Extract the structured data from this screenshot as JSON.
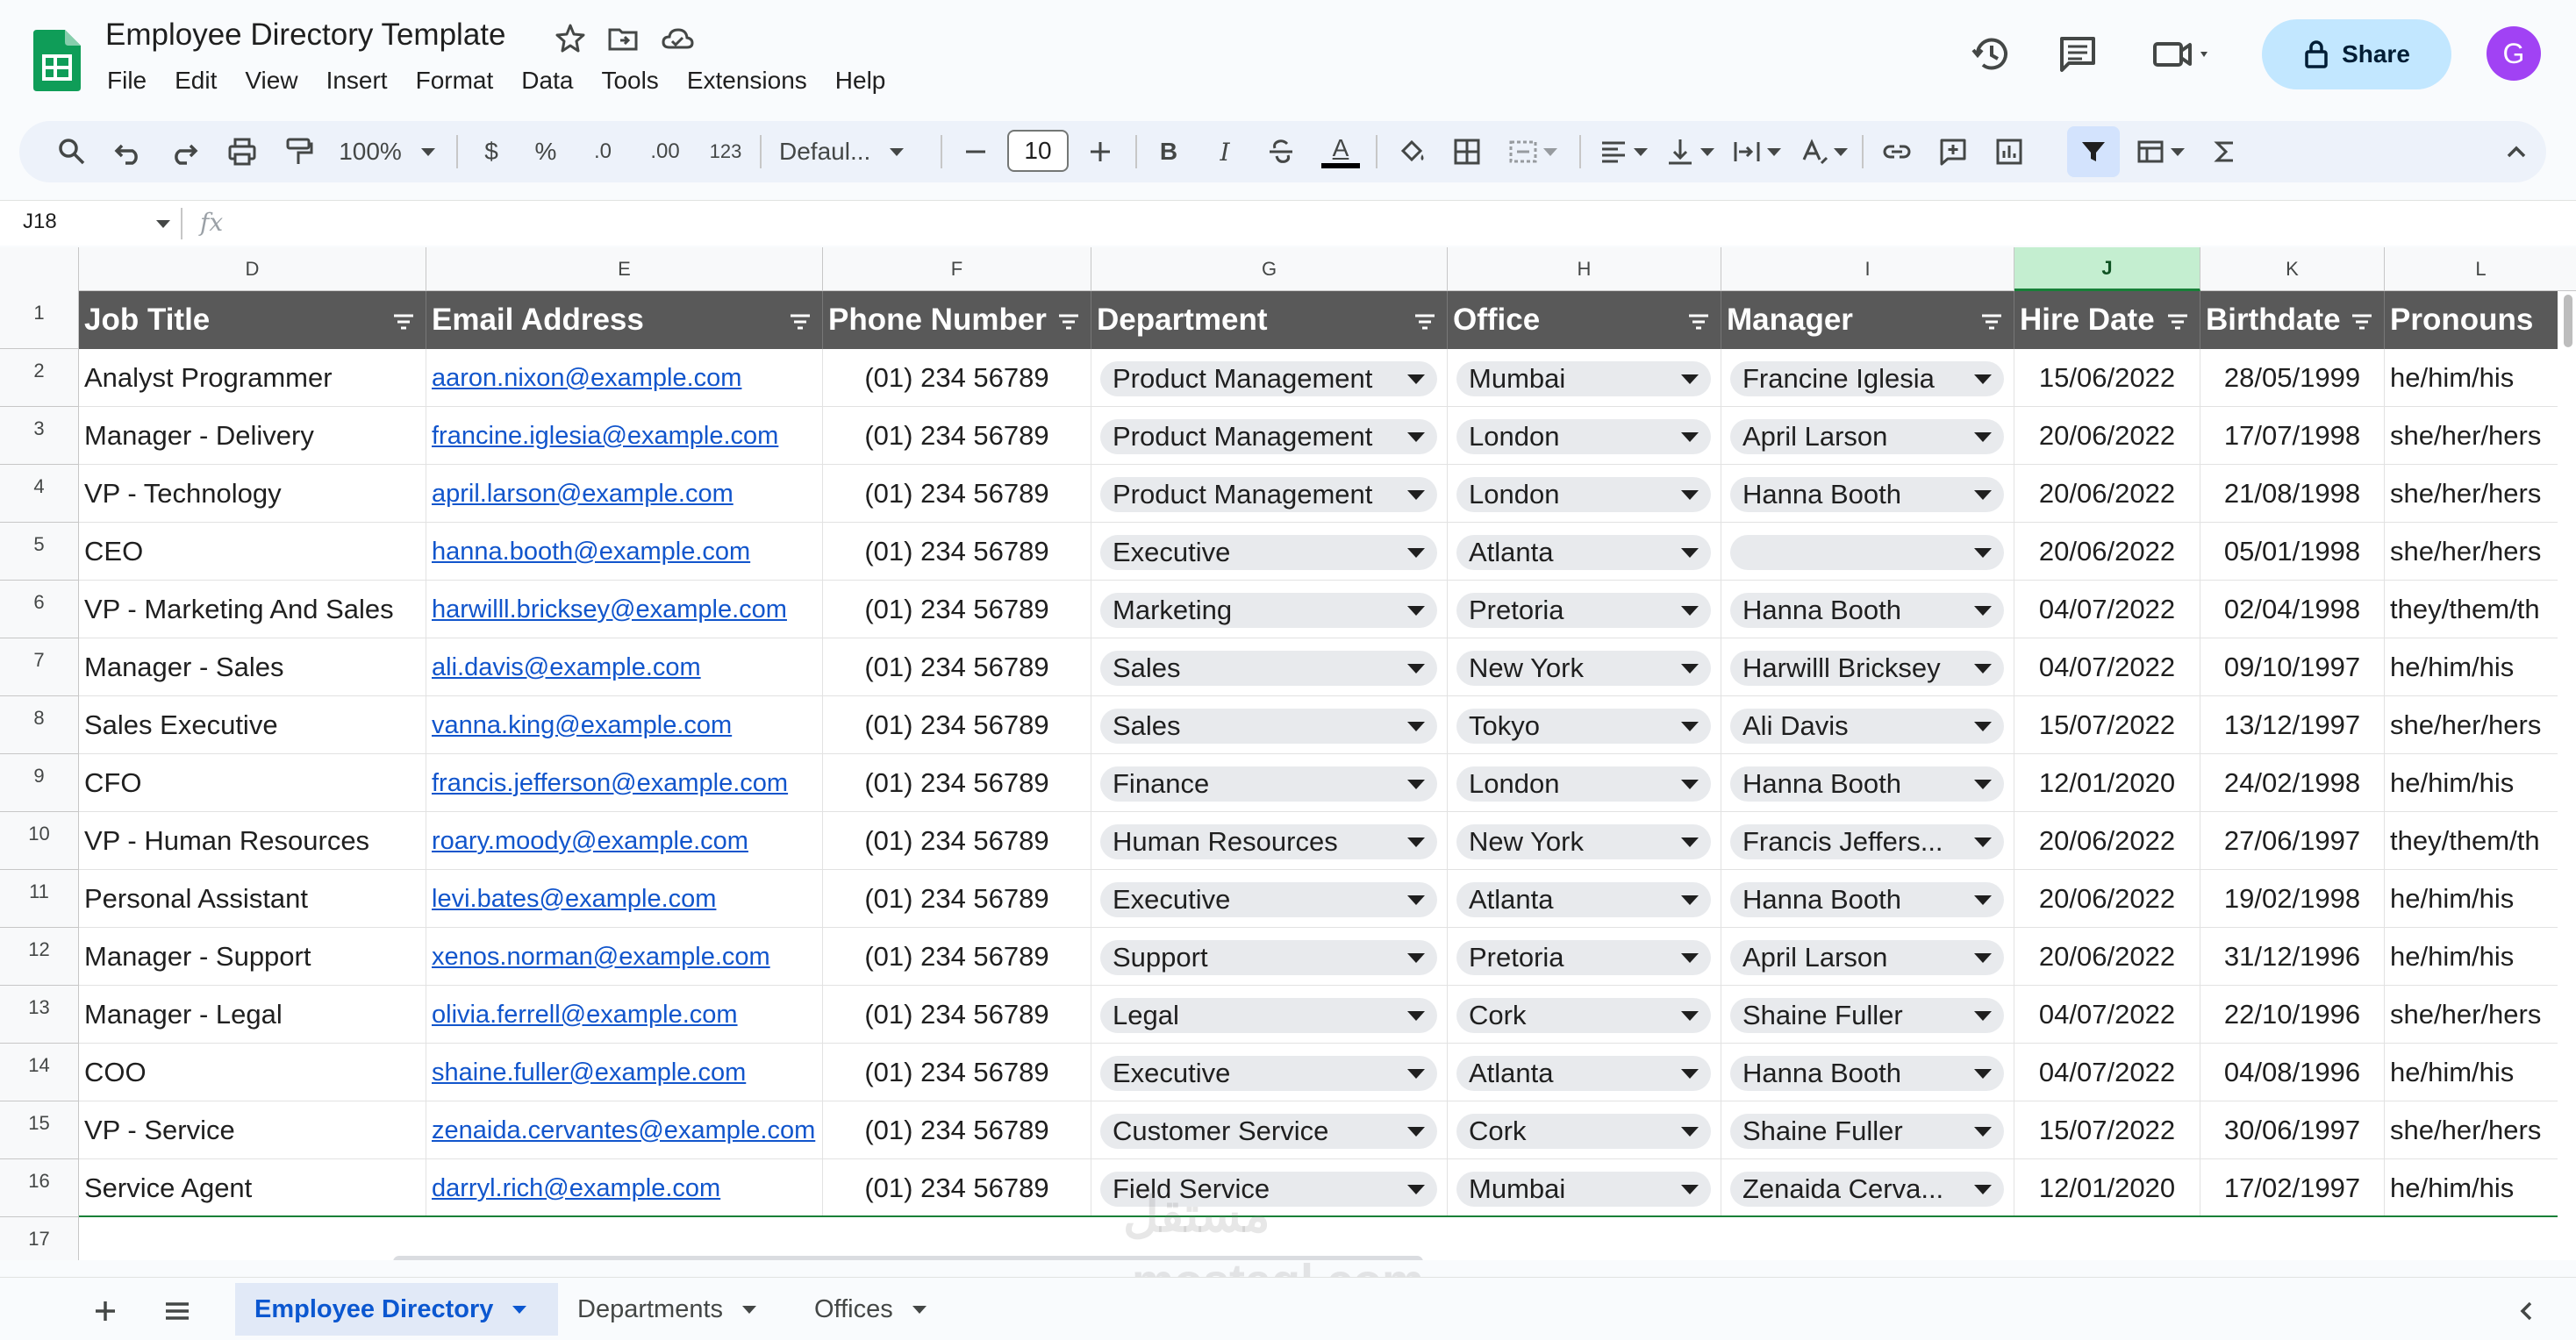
{
  "document": {
    "title": "Employee Directory Template",
    "menus": [
      "File",
      "Edit",
      "View",
      "Insert",
      "Format",
      "Data",
      "Tools",
      "Extensions",
      "Help"
    ]
  },
  "header_actions": {
    "share_label": "Share",
    "avatar_initial": "G"
  },
  "toolbar": {
    "zoom": "100%",
    "currency_symbol": "$",
    "percent_symbol": "%",
    "decrease_decimal": ".0",
    "increase_decimal": ".00",
    "number_format": "123",
    "font": "Defaul...",
    "font_size": "10",
    "bold": "B",
    "italic": "I",
    "text_color": "A",
    "icons": [
      "search-icon",
      "undo-icon",
      "redo-icon",
      "print-icon",
      "paint-format-icon",
      "font-decrease-icon",
      "font-increase-icon",
      "strikethrough-icon",
      "fill-color-icon",
      "borders-icon",
      "merge-icon",
      "align-icon",
      "valign-icon",
      "wrap-icon",
      "rotate-icon",
      "link-icon",
      "comment-icon",
      "chart-icon",
      "filter-icon",
      "table-view-icon",
      "sum-icon"
    ]
  },
  "formula_bar": {
    "name_box": "J18",
    "fx": "fx",
    "value": ""
  },
  "columns": [
    {
      "letter": "D",
      "selected": false
    },
    {
      "letter": "E",
      "selected": false
    },
    {
      "letter": "F",
      "selected": false
    },
    {
      "letter": "G",
      "selected": false
    },
    {
      "letter": "H",
      "selected": false
    },
    {
      "letter": "I",
      "selected": false
    },
    {
      "letter": "J",
      "selected": true
    },
    {
      "letter": "K",
      "selected": false
    },
    {
      "letter": "L",
      "selected": false
    }
  ],
  "table_headers": [
    "Job Title",
    "Email Address",
    "Phone Number",
    "Department",
    "Office",
    "Manager",
    "Hire Date",
    "Birthdate",
    "Pronouns"
  ],
  "row_numbers": [
    "1",
    "2",
    "3",
    "4",
    "5",
    "6",
    "7",
    "8",
    "9",
    "10",
    "11",
    "12",
    "13",
    "14",
    "15",
    "16",
    "17"
  ],
  "rows": [
    [
      "Analyst Programmer",
      "aaron.nixon@example.com",
      "(01) 234 56789",
      "Product Management",
      "Mumbai",
      "Francine Iglesia",
      "15/06/2022",
      "28/05/1999",
      "he/him/his"
    ],
    [
      "Manager - Delivery",
      "francine.iglesia@example.com",
      "(01) 234 56789",
      "Product Management",
      "London",
      "April Larson",
      "20/06/2022",
      "17/07/1998",
      "she/her/hers"
    ],
    [
      "VP - Technology",
      "april.larson@example.com",
      "(01) 234 56789",
      "Product Management",
      "London",
      "Hanna Booth",
      "20/06/2022",
      "21/08/1998",
      "she/her/hers"
    ],
    [
      "CEO",
      "hanna.booth@example.com",
      "(01) 234 56789",
      "Executive",
      "Atlanta",
      "",
      "20/06/2022",
      "05/01/1998",
      "she/her/hers"
    ],
    [
      "VP - Marketing And Sales",
      "harwilll.bricksey@example.com",
      "(01) 234 56789",
      "Marketing",
      "Pretoria",
      "Hanna Booth",
      "04/07/2022",
      "02/04/1998",
      "they/them/th"
    ],
    [
      "Manager - Sales",
      "ali.davis@example.com",
      "(01) 234 56789",
      "Sales",
      "New York",
      "Harwilll Bricksey",
      "04/07/2022",
      "09/10/1997",
      "he/him/his"
    ],
    [
      "Sales Executive",
      "vanna.king@example.com",
      "(01) 234 56789",
      "Sales",
      "Tokyo",
      "Ali Davis",
      "15/07/2022",
      "13/12/1997",
      "she/her/hers"
    ],
    [
      "CFO",
      "francis.jefferson@example.com",
      "(01) 234 56789",
      "Finance",
      "London",
      "Hanna Booth",
      "12/01/2020",
      "24/02/1998",
      "he/him/his"
    ],
    [
      "VP - Human Resources",
      "roary.moody@example.com",
      "(01) 234 56789",
      "Human Resources",
      "New York",
      "Francis Jeffers...",
      "20/06/2022",
      "27/06/1997",
      "they/them/th"
    ],
    [
      "Personal Assistant",
      "levi.bates@example.com",
      "(01) 234 56789",
      "Executive",
      "Atlanta",
      "Hanna Booth",
      "20/06/2022",
      "19/02/1998",
      "he/him/his"
    ],
    [
      "Manager - Support",
      "xenos.norman@example.com",
      "(01) 234 56789",
      "Support",
      "Pretoria",
      "April Larson",
      "20/06/2022",
      "31/12/1996",
      "he/him/his"
    ],
    [
      "Manager - Legal",
      "olivia.ferrell@example.com",
      "(01) 234 56789",
      "Legal",
      "Cork",
      "Shaine Fuller",
      "04/07/2022",
      "22/10/1996",
      "she/her/hers"
    ],
    [
      "COO",
      "shaine.fuller@example.com",
      "(01) 234 56789",
      "Executive",
      "Atlanta",
      "Hanna Booth",
      "04/07/2022",
      "04/08/1996",
      "he/him/his"
    ],
    [
      "VP - Service",
      "zenaida.cervantes@example.com",
      "(01) 234 56789",
      "Customer Service",
      "Cork",
      "Shaine Fuller",
      "15/07/2022",
      "30/06/1997",
      "she/her/hers"
    ],
    [
      "Service Agent",
      "darryl.rich@example.com",
      "(01) 234 56789",
      "Field Service",
      "Mumbai",
      "Zenaida Cerva...",
      "12/01/2020",
      "17/02/1997",
      "he/him/his"
    ]
  ],
  "sheet_tabs": [
    {
      "label": "Employee Directory",
      "active": true
    },
    {
      "label": "Departments",
      "active": false
    },
    {
      "label": "Offices",
      "active": false
    }
  ],
  "watermark": {
    "arabic": "مستقل",
    "latin": "mostaql.com"
  },
  "colors": {
    "header_fill": "#595959",
    "selected_column": "#c4eed0",
    "share_button": "#c2e7ff",
    "avatar": "#a142f4",
    "link": "#1155cc",
    "active_tab": "#0b57d0"
  }
}
